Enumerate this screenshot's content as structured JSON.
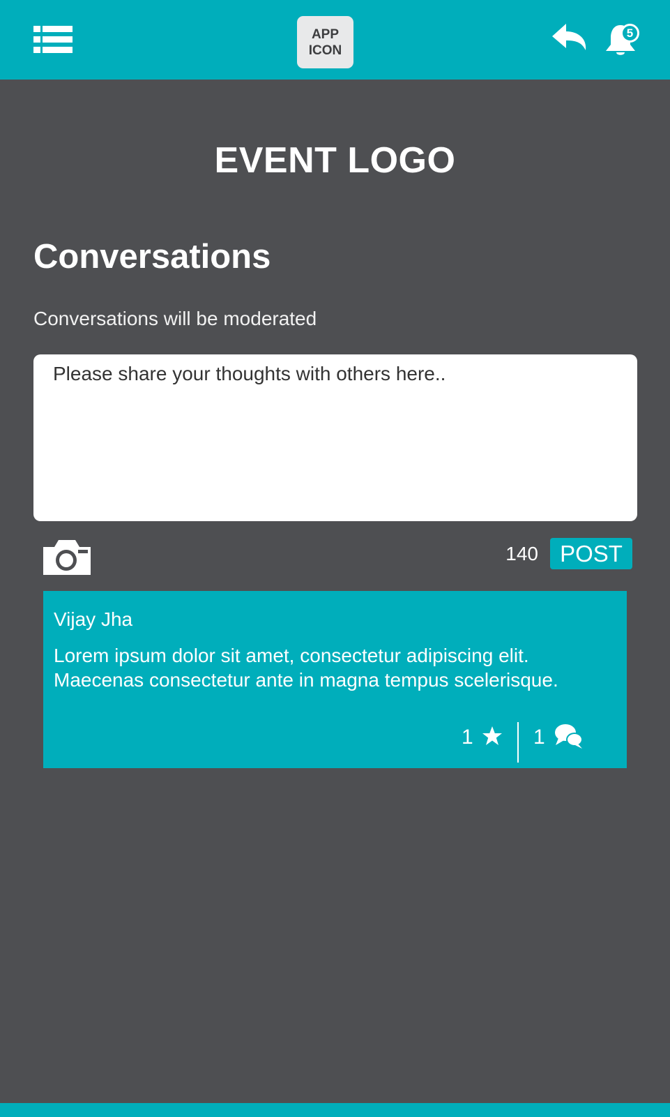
{
  "header": {
    "app_icon_line1": "APP",
    "app_icon_line2": "ICON",
    "notification_count": "5",
    "icons": [
      "list-menu-icon",
      "reply-back-icon",
      "bell-icon"
    ]
  },
  "event": {
    "logo_text": "EVENT LOGO"
  },
  "page": {
    "title": "Conversations",
    "moderation_note": "Conversations will be moderated"
  },
  "composer": {
    "placeholder": "Please share your thoughts with others here..",
    "value": "",
    "char_remaining": "140",
    "post_label": "POST",
    "camera_icon": "camera-icon"
  },
  "posts": [
    {
      "author": "Vijay Jha",
      "body": "Lorem ipsum dolor sit amet, consectetur adipiscing elit. Maecenas consectetur ante in magna tempus scelerisque.",
      "likes": "1",
      "comments": "1"
    }
  ],
  "colors": {
    "accent": "#00aebb",
    "background": "#4e4f52",
    "surface": "#ffffff",
    "app_icon_bg": "#e8e9ea"
  }
}
